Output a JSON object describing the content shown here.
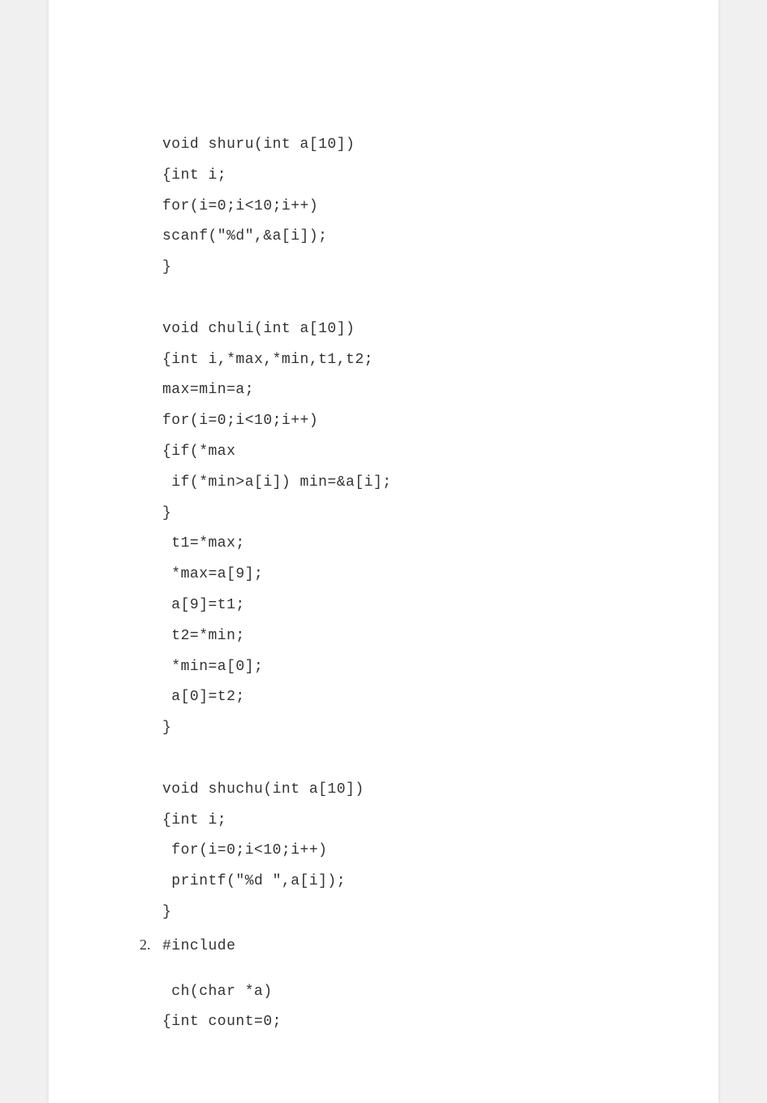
{
  "code1": "void shuru(int a[10])\n{int i;\nfor(i=0;i<10;i++)\nscanf(\"%d\",&a[i]);\n}\n\nvoid chuli(int a[10])\n{int i,*max,*min,t1,t2;\nmax=min=a;\nfor(i=0;i<10;i++)\n{if(*max\n if(*min>a[i]) min=&a[i];\n}\n t1=*max;\n *max=a[9];\n a[9]=t1;\n t2=*min;\n *min=a[0];\n a[0]=t2;\n}\n\nvoid shuchu(int a[10])\n{int i;\n for(i=0;i<10;i++)\n printf(\"%d \",a[i]);\n}",
  "list2": {
    "num": "2.",
    "text": "#include"
  },
  "code2": " ch(char *a)\n{int count=0;"
}
